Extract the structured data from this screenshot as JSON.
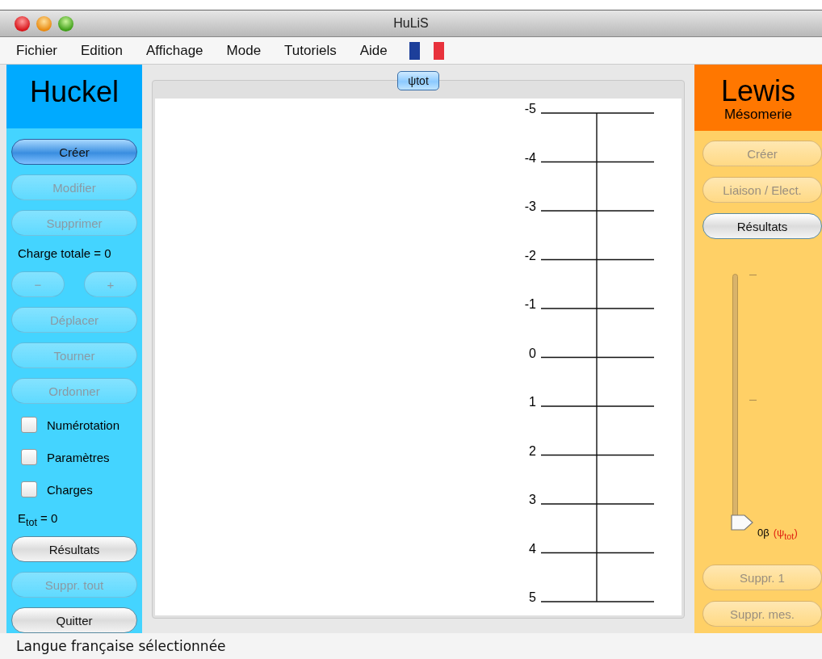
{
  "window": {
    "title": "HuLiS"
  },
  "menu": [
    "Fichier",
    "Edition",
    "Affichage",
    "Mode",
    "Tutoriels",
    "Aide"
  ],
  "left": {
    "title": "Huckel",
    "items": [
      {
        "kind": "button",
        "label": "Créer",
        "selected": true,
        "disabled": false
      },
      {
        "kind": "button",
        "label": "Modifier",
        "selected": false,
        "disabled": true
      },
      {
        "kind": "button",
        "label": "Supprimer",
        "selected": false,
        "disabled": true
      },
      {
        "kind": "label",
        "text": "Charge totale = 0"
      },
      {
        "kind": "stepper",
        "minus": "−",
        "plus": "+",
        "disabled": true
      },
      {
        "kind": "button",
        "label": "Déplacer",
        "selected": false,
        "disabled": true
      },
      {
        "kind": "button",
        "label": "Tourner",
        "selected": false,
        "disabled": true
      },
      {
        "kind": "button",
        "label": "Ordonner",
        "selected": false,
        "disabled": true
      },
      {
        "kind": "checkbox",
        "label": "Numérotation",
        "checked": false
      },
      {
        "kind": "checkbox",
        "label": "Paramètres",
        "checked": false
      },
      {
        "kind": "checkbox",
        "label": "Charges",
        "checked": false
      },
      {
        "kind": "label",
        "text": "E$_{tot}$ = 0"
      },
      {
        "kind": "button",
        "label": "Résultats",
        "selected": false,
        "disabled": false
      },
      {
        "kind": "button",
        "label": "Suppr. tout",
        "selected": false,
        "disabled": true
      },
      {
        "kind": "button",
        "label": "Quitter",
        "selected": false,
        "disabled": false
      }
    ]
  },
  "center": {
    "tab": "ψtot",
    "levels": [
      "-5",
      "-4",
      "-3",
      "-2",
      "-1",
      "0",
      "1",
      "2",
      "3",
      "4",
      "5"
    ]
  },
  "right": {
    "title": "Lewis",
    "subtitle": "Mésomerie",
    "buttons_top": [
      {
        "label": "Créer",
        "disabled": true
      },
      {
        "label": "Liaison / Elect.",
        "disabled": true
      },
      {
        "label": "Résultats",
        "disabled": false
      }
    ],
    "slider": {
      "level": 0,
      "value": "0β",
      "caption": "(ψ$_{tot}$)"
    },
    "buttons_bottom": [
      {
        "label": "Suppr. 1",
        "disabled": true
      },
      {
        "label": "Suppr. mes.",
        "disabled": true
      }
    ]
  },
  "status_bar": "Langue française sélectionnée"
}
